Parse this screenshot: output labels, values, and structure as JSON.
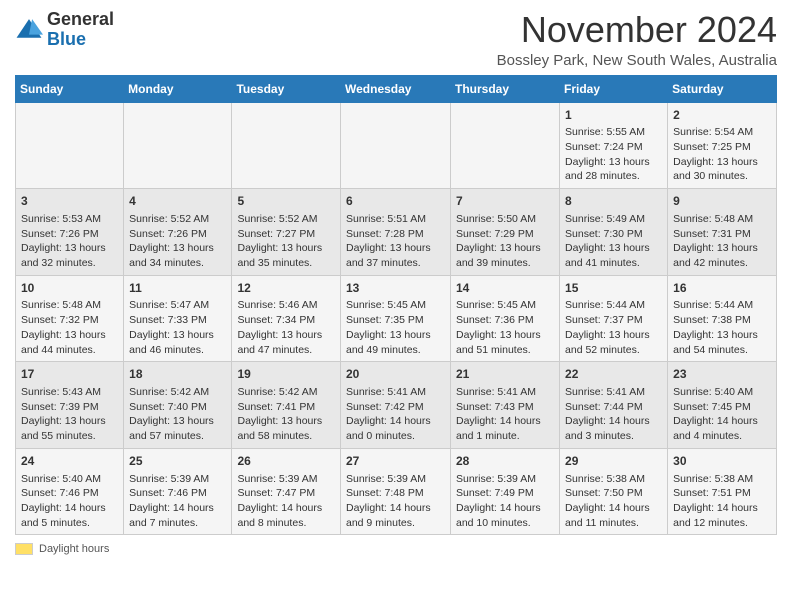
{
  "header": {
    "logo_general": "General",
    "logo_blue": "Blue",
    "month_title": "November 2024",
    "location": "Bossley Park, New South Wales, Australia"
  },
  "days_of_week": [
    "Sunday",
    "Monday",
    "Tuesday",
    "Wednesday",
    "Thursday",
    "Friday",
    "Saturday"
  ],
  "weeks": [
    [
      {
        "day": "",
        "info": ""
      },
      {
        "day": "",
        "info": ""
      },
      {
        "day": "",
        "info": ""
      },
      {
        "day": "",
        "info": ""
      },
      {
        "day": "",
        "info": ""
      },
      {
        "day": "1",
        "info": "Sunrise: 5:55 AM\nSunset: 7:24 PM\nDaylight: 13 hours and 28 minutes."
      },
      {
        "day": "2",
        "info": "Sunrise: 5:54 AM\nSunset: 7:25 PM\nDaylight: 13 hours and 30 minutes."
      }
    ],
    [
      {
        "day": "3",
        "info": "Sunrise: 5:53 AM\nSunset: 7:26 PM\nDaylight: 13 hours and 32 minutes."
      },
      {
        "day": "4",
        "info": "Sunrise: 5:52 AM\nSunset: 7:26 PM\nDaylight: 13 hours and 34 minutes."
      },
      {
        "day": "5",
        "info": "Sunrise: 5:52 AM\nSunset: 7:27 PM\nDaylight: 13 hours and 35 minutes."
      },
      {
        "day": "6",
        "info": "Sunrise: 5:51 AM\nSunset: 7:28 PM\nDaylight: 13 hours and 37 minutes."
      },
      {
        "day": "7",
        "info": "Sunrise: 5:50 AM\nSunset: 7:29 PM\nDaylight: 13 hours and 39 minutes."
      },
      {
        "day": "8",
        "info": "Sunrise: 5:49 AM\nSunset: 7:30 PM\nDaylight: 13 hours and 41 minutes."
      },
      {
        "day": "9",
        "info": "Sunrise: 5:48 AM\nSunset: 7:31 PM\nDaylight: 13 hours and 42 minutes."
      }
    ],
    [
      {
        "day": "10",
        "info": "Sunrise: 5:48 AM\nSunset: 7:32 PM\nDaylight: 13 hours and 44 minutes."
      },
      {
        "day": "11",
        "info": "Sunrise: 5:47 AM\nSunset: 7:33 PM\nDaylight: 13 hours and 46 minutes."
      },
      {
        "day": "12",
        "info": "Sunrise: 5:46 AM\nSunset: 7:34 PM\nDaylight: 13 hours and 47 minutes."
      },
      {
        "day": "13",
        "info": "Sunrise: 5:45 AM\nSunset: 7:35 PM\nDaylight: 13 hours and 49 minutes."
      },
      {
        "day": "14",
        "info": "Sunrise: 5:45 AM\nSunset: 7:36 PM\nDaylight: 13 hours and 51 minutes."
      },
      {
        "day": "15",
        "info": "Sunrise: 5:44 AM\nSunset: 7:37 PM\nDaylight: 13 hours and 52 minutes."
      },
      {
        "day": "16",
        "info": "Sunrise: 5:44 AM\nSunset: 7:38 PM\nDaylight: 13 hours and 54 minutes."
      }
    ],
    [
      {
        "day": "17",
        "info": "Sunrise: 5:43 AM\nSunset: 7:39 PM\nDaylight: 13 hours and 55 minutes."
      },
      {
        "day": "18",
        "info": "Sunrise: 5:42 AM\nSunset: 7:40 PM\nDaylight: 13 hours and 57 minutes."
      },
      {
        "day": "19",
        "info": "Sunrise: 5:42 AM\nSunset: 7:41 PM\nDaylight: 13 hours and 58 minutes."
      },
      {
        "day": "20",
        "info": "Sunrise: 5:41 AM\nSunset: 7:42 PM\nDaylight: 14 hours and 0 minutes."
      },
      {
        "day": "21",
        "info": "Sunrise: 5:41 AM\nSunset: 7:43 PM\nDaylight: 14 hours and 1 minute."
      },
      {
        "day": "22",
        "info": "Sunrise: 5:41 AM\nSunset: 7:44 PM\nDaylight: 14 hours and 3 minutes."
      },
      {
        "day": "23",
        "info": "Sunrise: 5:40 AM\nSunset: 7:45 PM\nDaylight: 14 hours and 4 minutes."
      }
    ],
    [
      {
        "day": "24",
        "info": "Sunrise: 5:40 AM\nSunset: 7:46 PM\nDaylight: 14 hours and 5 minutes."
      },
      {
        "day": "25",
        "info": "Sunrise: 5:39 AM\nSunset: 7:46 PM\nDaylight: 14 hours and 7 minutes."
      },
      {
        "day": "26",
        "info": "Sunrise: 5:39 AM\nSunset: 7:47 PM\nDaylight: 14 hours and 8 minutes."
      },
      {
        "day": "27",
        "info": "Sunrise: 5:39 AM\nSunset: 7:48 PM\nDaylight: 14 hours and 9 minutes."
      },
      {
        "day": "28",
        "info": "Sunrise: 5:39 AM\nSunset: 7:49 PM\nDaylight: 14 hours and 10 minutes."
      },
      {
        "day": "29",
        "info": "Sunrise: 5:38 AM\nSunset: 7:50 PM\nDaylight: 14 hours and 11 minutes."
      },
      {
        "day": "30",
        "info": "Sunrise: 5:38 AM\nSunset: 7:51 PM\nDaylight: 14 hours and 12 minutes."
      }
    ]
  ],
  "legend": {
    "daylight_label": "Daylight hours"
  }
}
